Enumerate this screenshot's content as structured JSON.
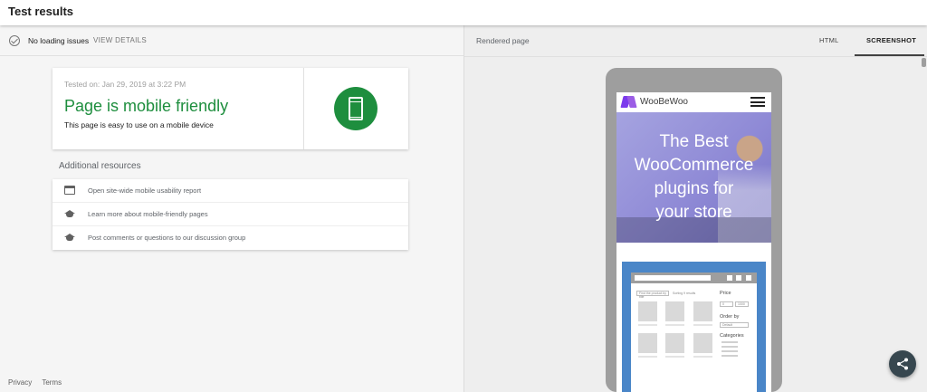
{
  "header": {
    "title": "Test results"
  },
  "status": {
    "text": "No loading issues",
    "action": "VIEW DETAILS"
  },
  "result": {
    "tested_on": "Tested on: Jan 29, 2019 at 3:22 PM",
    "title": "Page is mobile friendly",
    "description": "This page is easy to use on a mobile device",
    "icon": "smartphone-icon",
    "accent_color": "#1e8e3e"
  },
  "additional_resources": {
    "title": "Additional resources",
    "items": [
      {
        "label": "Open site-wide mobile usability report",
        "icon": "report-window-icon"
      },
      {
        "label": "Learn more about mobile-friendly pages",
        "icon": "school-icon"
      },
      {
        "label": "Post comments or questions to our discussion group",
        "icon": "school-icon"
      }
    ]
  },
  "footer": {
    "privacy": "Privacy",
    "terms": "Terms"
  },
  "rendered": {
    "label": "Rendered page",
    "tabs": [
      {
        "label": "HTML",
        "selected": false
      },
      {
        "label": "SCREENSHOT",
        "selected": true
      }
    ]
  },
  "preview": {
    "brand": "WooBeWoo",
    "hero_lines": [
      "The Best",
      "WooCommerce",
      "plugins for",
      "your store"
    ],
    "hero_color": "#8f8ad6",
    "shop_color": "#4a86c8",
    "sidebar": {
      "price": "Price",
      "order_by": "Order by",
      "order_value": "Default",
      "categories": "Categories",
      "price_min": "0",
      "price_max": "1000"
    },
    "search_placeholder": "Find the product by title",
    "sort_label": "Sorting 9 results"
  },
  "fab": {
    "icon": "share-icon"
  }
}
